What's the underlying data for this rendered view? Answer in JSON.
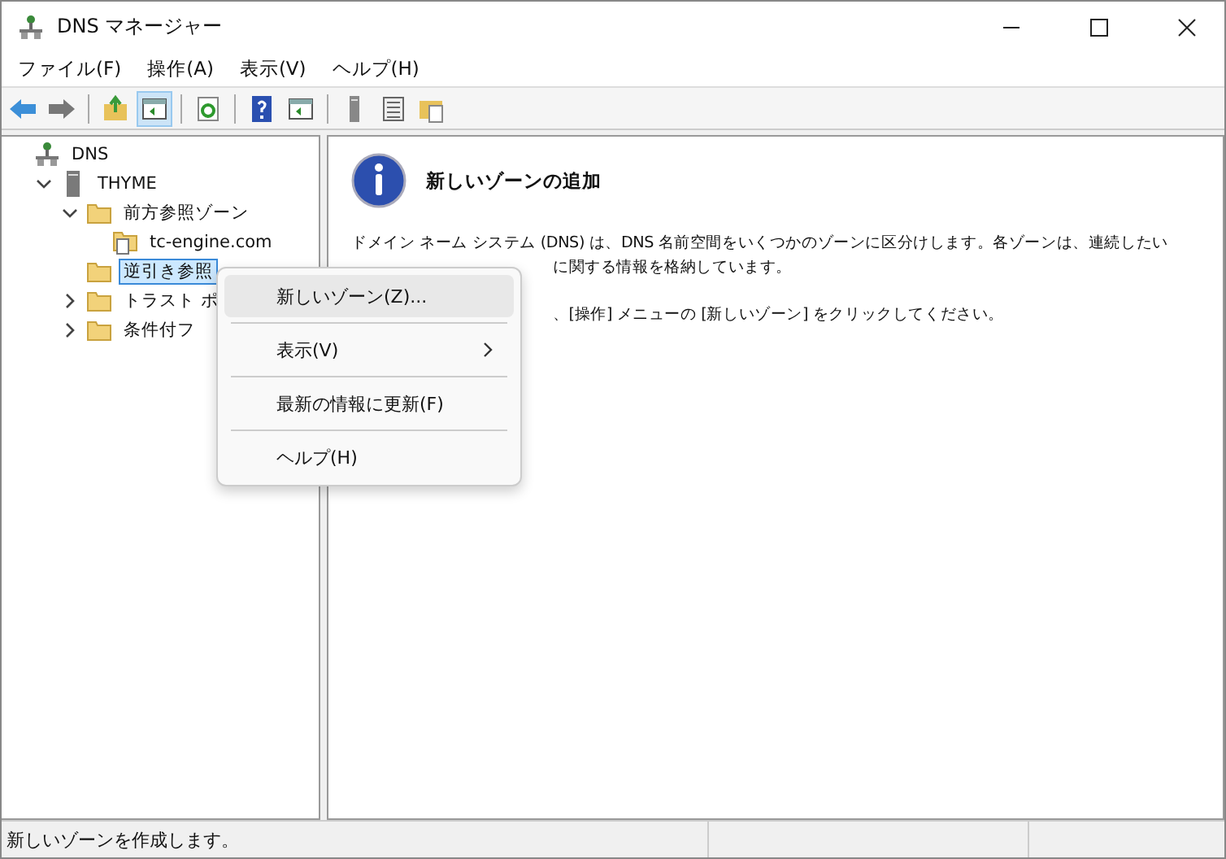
{
  "window": {
    "title": "DNS マネージャー"
  },
  "menu_bar": [
    "ファイル(F)",
    "操作(A)",
    "表示(V)",
    "ヘルプ(H)"
  ],
  "toolbar": [
    {
      "kind": "back"
    },
    {
      "kind": "forward"
    },
    {
      "kind": "sep"
    },
    {
      "kind": "up"
    },
    {
      "kind": "pane",
      "selected": true
    },
    {
      "kind": "sep"
    },
    {
      "kind": "refresh"
    },
    {
      "kind": "sep"
    },
    {
      "kind": "help"
    },
    {
      "kind": "action"
    },
    {
      "kind": "sep"
    },
    {
      "kind": "server"
    },
    {
      "kind": "list"
    },
    {
      "kind": "folderdoc"
    }
  ],
  "tree": [
    {
      "label": "DNS",
      "kind": "dns",
      "selected": false,
      "children": [
        {
          "label": "THYME",
          "kind": "server",
          "expanded": true,
          "selected": false,
          "children": [
            {
              "label": "前方参照ゾーン",
              "kind": "folder",
              "expanded": true,
              "selected": false,
              "children": [
                {
                  "label": "tc-engine.com",
                  "kind": "zone",
                  "selected": false
                }
              ]
            },
            {
              "label": "逆引き参照",
              "kind": "folder",
              "selected": true
            },
            {
              "label": "トラスト ポ",
              "kind": "folder",
              "expanded": false,
              "selected": false
            },
            {
              "label": "条件付フ",
              "kind": "folder",
              "expanded": false,
              "selected": false
            }
          ]
        }
      ]
    }
  ],
  "details": {
    "heading": "新しいゾーンの追加",
    "paragraph_1": [
      "ドメイン ネーム システム (DNS) は、DNS 名前空間をいくつかのゾーンに区分けします。各ゾーンは、連続したい",
      "に関する情報を格納しています。"
    ],
    "paragraph_2": "、[操作] メニューの [新しいゾーン] をクリックしてください。"
  },
  "context_menu": [
    {
      "label": "新しいゾーン(Z)...",
      "kind": "item",
      "selected": true
    },
    {
      "label": "表示(V)",
      "kind": "submenu",
      "selected": false
    },
    {
      "label": "最新の情報に更新(F)",
      "kind": "item",
      "selected": false
    },
    {
      "label": "ヘルプ(H)",
      "kind": "item",
      "selected": false
    }
  ],
  "status_bar": {
    "text": "新しいゾーンを作成します。"
  }
}
